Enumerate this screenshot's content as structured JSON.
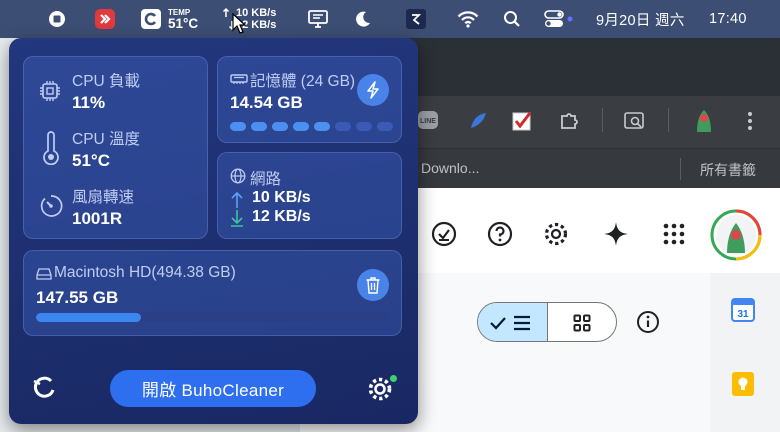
{
  "menubar": {
    "temp_label": "TEMP",
    "temp_value": "51°C",
    "net_up": "10 KB/s",
    "net_down": "12 KB/s",
    "date": "9月20日 週六",
    "time": "17:40"
  },
  "browser": {
    "bookmark_downloads": "Downlo...",
    "bookmark_all": "所有書籤"
  },
  "popover": {
    "cpu_load": {
      "label": "CPU 負載",
      "value": "11%"
    },
    "cpu_temp": {
      "label": "CPU 溫度",
      "value": "51°C"
    },
    "fan": {
      "label": "風扇轉速",
      "value": "1001R"
    },
    "memory": {
      "label": "記憶體 (24 GB)",
      "value": "14.54 GB",
      "level_segments": 5,
      "total_segments": 8
    },
    "network": {
      "label": "網路",
      "upload": "10 KB/s",
      "download": "12 KB/s"
    },
    "disk": {
      "label": "Macintosh HD(494.38 GB)",
      "value": "147.55 GB",
      "used_fraction": 0.298
    },
    "open_button": "開啟 BuhoCleaner"
  },
  "colors": {
    "popover_bg": "#1f3273",
    "accent_blue": "#2e6ff0",
    "green_status": "#3fd06b",
    "menubar_bg": "#3d4e74"
  }
}
